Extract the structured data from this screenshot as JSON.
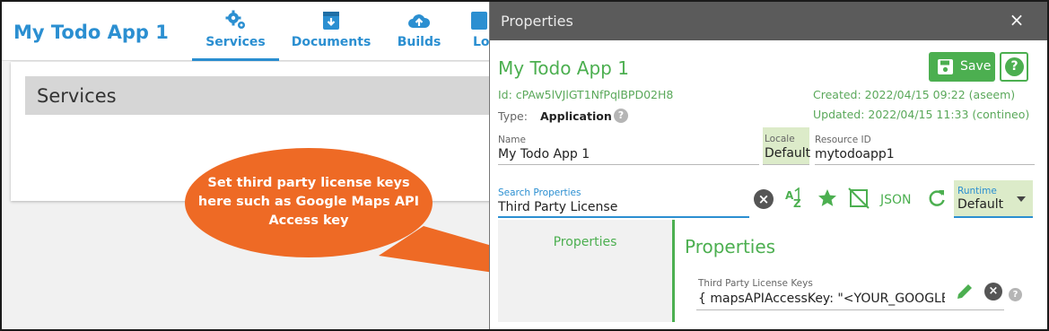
{
  "app": {
    "title": "My Todo App 1",
    "tabs": [
      {
        "label": "Services",
        "icon": "gears-icon",
        "active": true
      },
      {
        "label": "Documents",
        "icon": "document-download-icon",
        "active": false
      },
      {
        "label": "Builds",
        "icon": "cloud-upload-icon",
        "active": false
      },
      {
        "label": "Lo",
        "icon": "file-icon",
        "active": false
      }
    ],
    "section_heading": "Services"
  },
  "callout": {
    "text_lines": [
      "Set third party license keys",
      "here such as Google Maps API",
      "Access key"
    ],
    "color": "#ee6a25"
  },
  "properties": {
    "header_title": "Properties",
    "close_glyph": "×",
    "app_name": "My Todo App 1",
    "save_label": "Save",
    "help_glyph": "?",
    "id_text": "Id: cPAw5lVJlGT1NfPqlBPD02H8",
    "type_label": "Type:",
    "type_value": "Application",
    "created": "Created: 2022/04/15 09:22 (aseem)",
    "updated": "Updated: 2022/04/15 11:33 (contineo)",
    "fields": {
      "name": {
        "label": "Name",
        "value": "My Todo App 1"
      },
      "locale": {
        "label": "Locale",
        "value": "Default"
      },
      "resource_id": {
        "label": "Resource ID",
        "value": "mytodoapp1"
      }
    },
    "search": {
      "label": "Search Properties",
      "value": "Third Party License"
    },
    "toolbar": {
      "json_label": "JSON"
    },
    "runtime": {
      "label": "Runtime",
      "value": "Default"
    },
    "side_nav_item": "Properties",
    "section_title": "Properties",
    "license_field": {
      "label": "Third Party License Keys",
      "value": "{  mapsAPIAccessKey: \"<YOUR_GOOGLE"
    }
  },
  "colors": {
    "brand_blue": "#2b8fd1",
    "accent_green": "#4caf50",
    "header_gray": "#5b5b5b"
  }
}
